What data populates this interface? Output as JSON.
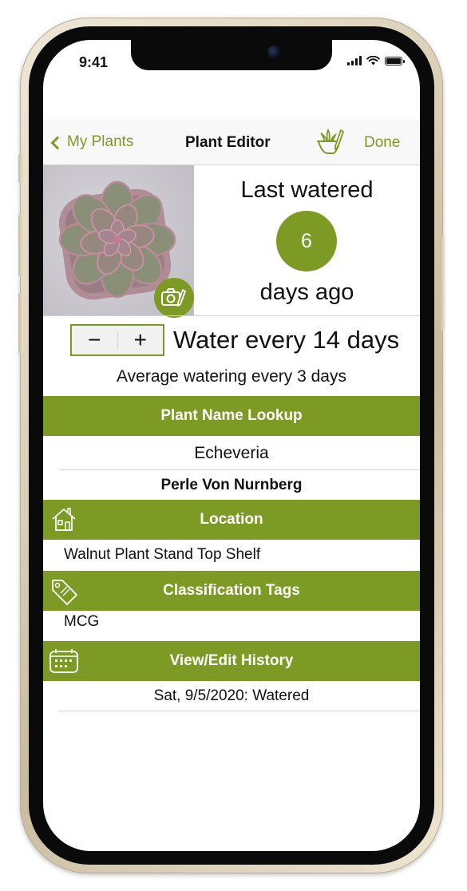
{
  "status_bar": {
    "time": "9:41"
  },
  "nav": {
    "back_label": "My Plants",
    "title": "Plant Editor",
    "done_label": "Done",
    "plant_icon": "plant-pencil-icon"
  },
  "watering": {
    "last_watered_label": "Last watered",
    "days_since": "6",
    "days_ago_label": "days ago",
    "decrement_label": "−",
    "increment_label": "+",
    "interval_text": "Water every 14 days",
    "average_text": "Average watering every 3 days"
  },
  "name_lookup": {
    "header": "Plant Name Lookup",
    "genus": "Echeveria",
    "cultivar": "Perle Von Nurnberg"
  },
  "location": {
    "header": "Location",
    "value": "Walnut Plant Stand Top Shelf"
  },
  "tags": {
    "header": "Classification Tags",
    "value": "MCG"
  },
  "history": {
    "header": "View/Edit History",
    "entries": [
      "Sat, 9/5/2020: Watered"
    ]
  },
  "colors": {
    "accent": "#7c9a24",
    "header_bg": "#7c9a24",
    "nav_bg": "#f8f8f8",
    "phone_frame": "#d9ceb6"
  }
}
